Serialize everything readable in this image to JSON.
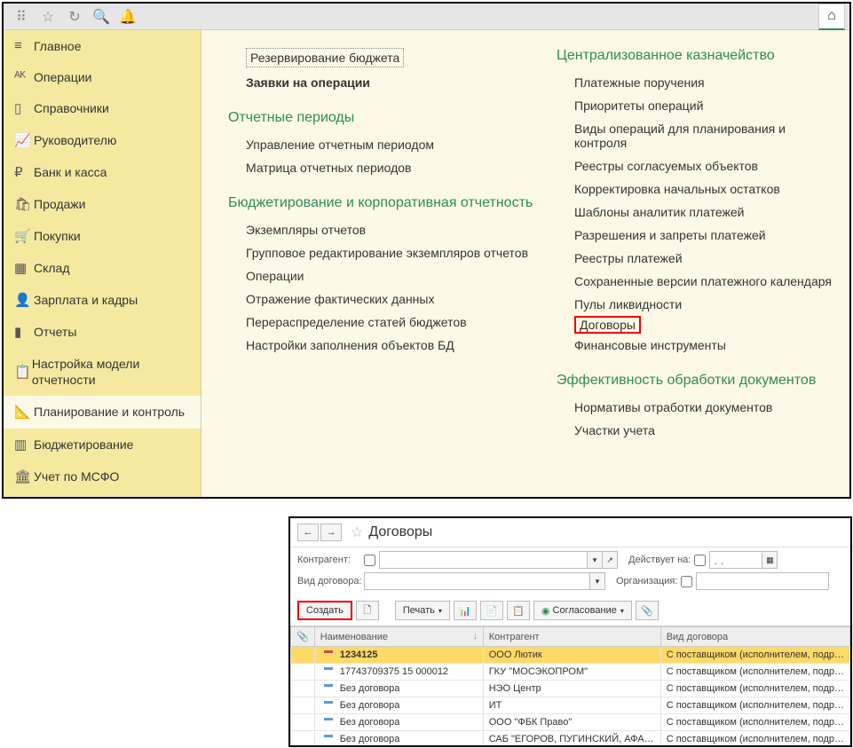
{
  "sidebar": {
    "items": [
      {
        "label": "Главное",
        "icon": "menu"
      },
      {
        "label": "Операции",
        "icon": "dtct"
      },
      {
        "label": "Справочники",
        "icon": "book"
      },
      {
        "label": "Руководителю",
        "icon": "chart"
      },
      {
        "label": "Банк и касса",
        "icon": "ruble"
      },
      {
        "label": "Продажи",
        "icon": "bag"
      },
      {
        "label": "Покупки",
        "icon": "cart"
      },
      {
        "label": "Склад",
        "icon": "boxes"
      },
      {
        "label": "Зарплата и кадры",
        "icon": "person"
      },
      {
        "label": "Отчеты",
        "icon": "bars"
      },
      {
        "label": "Настройка модели отчетности",
        "icon": "clipboard"
      },
      {
        "label": "Планирование и контроль",
        "icon": "plan",
        "active": true
      },
      {
        "label": "Бюджетирование",
        "icon": "budget"
      },
      {
        "label": "Учет по МСФО",
        "icon": "msfo"
      }
    ]
  },
  "main": {
    "left": {
      "top_links": [
        {
          "text": "Резервирование бюджета",
          "boxed": true
        },
        {
          "text": "Заявки на операции",
          "bold": true
        }
      ],
      "sections": [
        {
          "title": "Отчетные периоды",
          "links": [
            "Управление отчетным периодом",
            "Матрица отчетных периодов"
          ]
        },
        {
          "title": "Бюджетирование и корпоративная отчетность",
          "links": [
            "Экземпляры отчетов",
            "Групповое редактирование экземпляров отчетов",
            "Операции",
            "Отражение фактических данных",
            "Перераспределение статей бюджетов",
            "Настройки заполнения объектов БД"
          ]
        }
      ]
    },
    "right": {
      "sections": [
        {
          "title": "Централизованное казначейство",
          "links": [
            "Платежные поручения",
            "Приоритеты операций",
            "Виды операций для планирования и контроля",
            "Реестры согласуемых объектов",
            "Корректировка начальных остатков",
            "Шаблоны аналитик платежей",
            "Разрешения и запреты платежей",
            "Реестры платежей",
            "Сохраненные версии платежного календаря",
            "Пулы ликвидности",
            "Договоры",
            "Финансовые инструменты"
          ],
          "highlight_index": 10
        },
        {
          "title": "Эффективность обработки документов",
          "links": [
            "Нормативы отработки документов",
            "Участки учета"
          ]
        }
      ]
    }
  },
  "window2": {
    "title": "Договоры",
    "filters": {
      "kontragent_label": "Контрагент:",
      "vid_label": "Вид договора:",
      "deistvuet_label": "Действует на:",
      "org_label": "Организация:",
      "date_placeholder": ". ."
    },
    "toolbar": {
      "create": "Создать",
      "print": "Печать",
      "soglas": "Согласование"
    },
    "columns": {
      "attach": "📎",
      "name": "Наименование",
      "kontragent": "Контрагент",
      "vid": "Вид договора"
    },
    "rows": [
      {
        "name": "1234125",
        "kontragent": "ООО Лютик",
        "vid": "С поставщиком (исполнителем, подрядчиком)",
        "selected": true
      },
      {
        "name": "17743709375 15 000012",
        "kontragent": "ГКУ \"МОСЭКОПРОМ\"",
        "vid": "С поставщиком (исполнителем, подрядчиком)"
      },
      {
        "name": "Без договора",
        "kontragent": "НЭО Центр",
        "vid": "С поставщиком (исполнителем, подрядчиком)"
      },
      {
        "name": "Без договора",
        "kontragent": "ИТ",
        "vid": "С поставщиком (исполнителем, подрядчиком)"
      },
      {
        "name": "Без договора",
        "kontragent": "ООО \"ФБК Право\"",
        "vid": "С поставщиком (исполнителем, подрядчиком)"
      },
      {
        "name": "Без договора",
        "kontragent": "САБ \"ЕГОРОВ, ПУГИНСКИЙ, АФАНАСЬЕВ ...",
        "vid": "С поставщиком (исполнителем, подрядчиком)"
      }
    ]
  }
}
